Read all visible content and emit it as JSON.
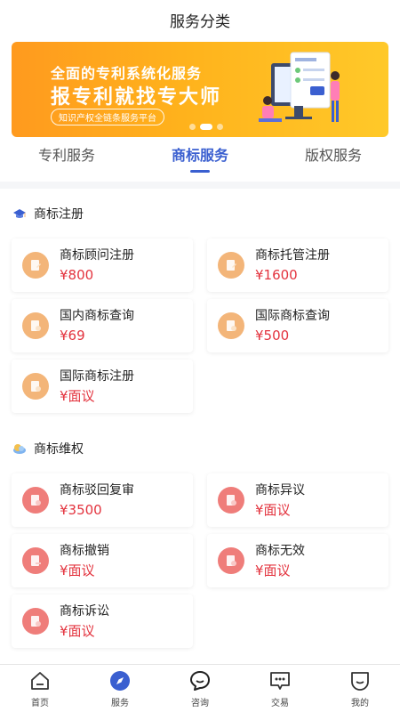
{
  "header": {
    "title": "服务分类"
  },
  "banner": {
    "line1": "全面的专利系统化服务",
    "line2": "报专利就找专大师",
    "line3": "知识产权全链条服务平台",
    "slide_count": 3,
    "active_slide": 1
  },
  "tabs": [
    {
      "label": "专利服务",
      "active": false
    },
    {
      "label": "商标服务",
      "active": true
    },
    {
      "label": "版权服务",
      "active": false
    }
  ],
  "sections": [
    {
      "title": "商标注册",
      "icon": "graduation-cap-icon",
      "items": [
        {
          "name": "商标顾问注册",
          "price": "¥800",
          "icon": "document-edit-icon",
          "color": "#f3b579"
        },
        {
          "name": "商标托管注册",
          "price": "¥1600",
          "icon": "document-edit-icon",
          "color": "#f3b579"
        },
        {
          "name": "国内商标查询",
          "price": "¥69",
          "icon": "document-search-icon",
          "color": "#f3b579"
        },
        {
          "name": "国际商标查询",
          "price": "¥500",
          "icon": "document-search-icon",
          "color": "#f3b579"
        },
        {
          "name": "国际商标注册",
          "price": "¥面议",
          "icon": "document-search-icon",
          "color": "#f3b579"
        }
      ]
    },
    {
      "title": "商标维权",
      "icon": "shield-cloud-icon",
      "items": [
        {
          "name": "商标驳回复审",
          "price": "¥3500",
          "icon": "document-minus-icon",
          "color": "#ef7d7a"
        },
        {
          "name": "商标异议",
          "price": "¥面议",
          "icon": "document-alert-icon",
          "color": "#ef7d7a"
        },
        {
          "name": "商标撤销",
          "price": "¥面议",
          "icon": "document-remove-icon",
          "color": "#ef7d7a"
        },
        {
          "name": "商标无效",
          "price": "¥面议",
          "icon": "document-info-icon",
          "color": "#ef7d7a"
        },
        {
          "name": "商标诉讼",
          "price": "¥面议",
          "icon": "document-check-icon",
          "color": "#ef7d7a"
        }
      ]
    }
  ],
  "bottom_nav": [
    {
      "label": "首页",
      "icon": "home-icon"
    },
    {
      "label": "服务",
      "icon": "compass-icon",
      "active": true
    },
    {
      "label": "咨询",
      "icon": "chat-bubble-icon"
    },
    {
      "label": "交易",
      "icon": "message-dots-icon"
    },
    {
      "label": "我的",
      "icon": "profile-icon"
    }
  ],
  "colors": {
    "accent": "#3a5fd0",
    "price": "#e3333e",
    "banner_orange": "#ffa41f"
  }
}
